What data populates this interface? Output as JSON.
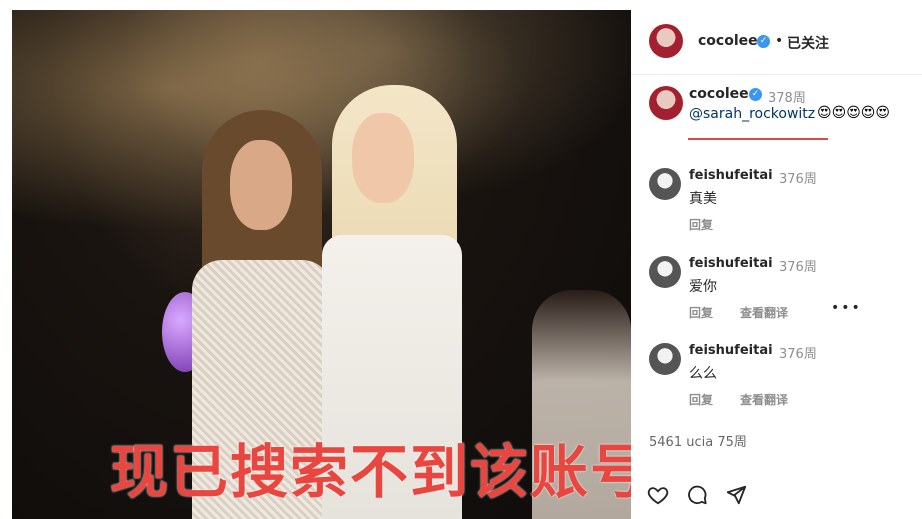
{
  "post": {
    "overlay_caption": "现已搜索不到该账号"
  },
  "header": {
    "username": "cocolee",
    "separator": "•",
    "follow_status": "已关注"
  },
  "caption": {
    "username": "cocolee",
    "time": "378周",
    "mention": "@sarah_rockowitz",
    "emojis": "😍😍😍😍😍"
  },
  "comments": [
    {
      "username": "feishufeitai",
      "time": "376周",
      "text": "真美",
      "reply": "回复",
      "translate": ""
    },
    {
      "username": "feishufeitai",
      "time": "376周",
      "text": "爱你",
      "reply": "回复",
      "translate": "查看翻译"
    },
    {
      "username": "feishufeitai",
      "time": "376周",
      "text": "么么",
      "reply": "回复",
      "translate": "查看翻译"
    }
  ],
  "partial_comment": "5461 ucia  75周",
  "icons": [
    "heart-icon",
    "comment-icon",
    "share-icon"
  ],
  "colors": {
    "accent_red": "#e64545",
    "overlay_red": "#e8463f",
    "verified_blue": "#3897f0"
  }
}
